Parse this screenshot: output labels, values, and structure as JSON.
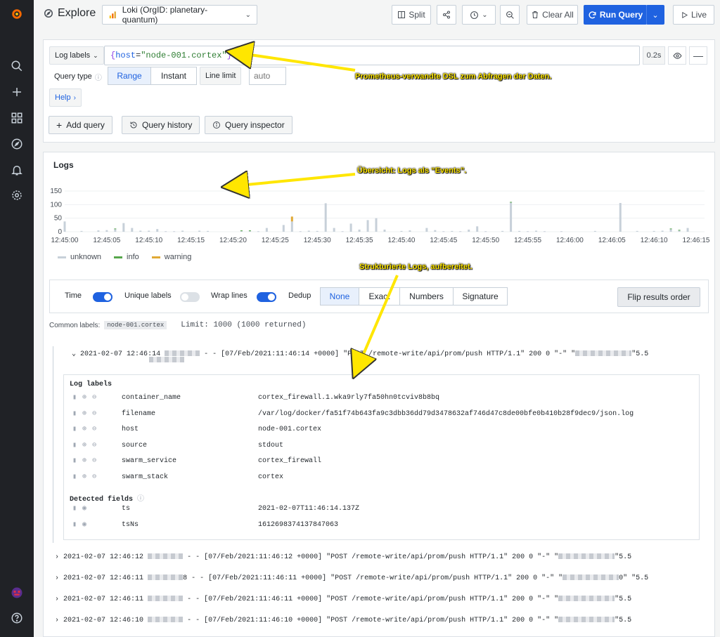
{
  "colors": {
    "primary": "#1f62e0",
    "sidebar": "#202226",
    "unknown": "#c7d0d9",
    "info": "#56a64b",
    "warning": "#e0a935",
    "annotation": "#ffe600"
  },
  "sidebar": {
    "items": [
      {
        "name": "grafana-logo-icon"
      },
      {
        "name": "search-icon"
      },
      {
        "name": "plus-icon"
      },
      {
        "name": "dashboards-icon"
      },
      {
        "name": "compass-icon"
      },
      {
        "name": "bell-icon"
      },
      {
        "name": "gear-icon"
      },
      {
        "name": "avatar"
      },
      {
        "name": "help-icon"
      }
    ]
  },
  "header": {
    "title": "Explore",
    "datasource": "Loki (OrgID: planetary-quantum)",
    "split": "Split",
    "clear_all": "Clear All",
    "run_query": "Run Query",
    "live": "Live"
  },
  "query": {
    "log_labels": "Log labels",
    "expression": {
      "brace_open": "{",
      "key": "host",
      "eq": "=",
      "value": "\"node-001.cortex\"",
      "brace_close": "}"
    },
    "duration": "0.2s",
    "query_type": "Query type",
    "range": "Range",
    "instant": "Instant",
    "line_limit": "Line limit",
    "line_limit_placeholder": "auto",
    "help": "Help",
    "add_query": "Add query",
    "query_history": "Query history",
    "query_inspector": "Query inspector"
  },
  "logs": {
    "title": "Logs",
    "legend": [
      "unknown",
      "info",
      "warning"
    ],
    "options": {
      "time": "Time",
      "unique_labels": "Unique labels",
      "wrap_lines": "Wrap lines",
      "dedup": "Dedup",
      "dedup_options": [
        "None",
        "Exact",
        "Numbers",
        "Signature"
      ],
      "flip": "Flip results order"
    },
    "common_labels": "Common labels:",
    "common_value": "node-001.cortex",
    "limit": "Limit: 1000 (1000 returned)",
    "rows": [
      {
        "ts": "2021-02-07 12:46:14",
        "line": " - - [07/Feb/2021:11:46:14 +0000] \"POST /remote-write/api/prom/push HTTP/1.1\" 200 0 \"-\" \"",
        "tail": "\"5.5",
        "expanded": true
      },
      {
        "ts": "2021-02-07 12:46:12",
        "line": " - - [07/Feb/2021:11:46:12 +0000] \"POST /remote-write/api/prom/push HTTP/1.1\" 200 0 \"-\" \"",
        "tail": "\"5.5"
      },
      {
        "ts": "2021-02-07 12:46:11",
        "line": "8 - - [07/Feb/2021:11:46:11 +0000] \"POST /remote-write/api/prom/push HTTP/1.1\" 200 0 \"-\" \"",
        "tail": "0\" \"5.5"
      },
      {
        "ts": "2021-02-07 12:46:11",
        "line": " - - [07/Feb/2021:11:46:11 +0000] \"POST /remote-write/api/prom/push HTTP/1.1\" 200 0 \"-\" \"",
        "tail": "\"5.5"
      },
      {
        "ts": "2021-02-07 12:46:10",
        "line": " - - [07/Feb/2021:11:46:10 +0000] \"POST /remote-write/api/prom/push HTTP/1.1\" 200 0 \"-\" \"",
        "tail": "\"5.5"
      }
    ],
    "detail": {
      "labels_title": "Log labels",
      "labels": [
        {
          "k": "container_name",
          "v": "cortex_firewall.1.wka9rly7fa50hn0tcviv8b8bq"
        },
        {
          "k": "filename",
          "v": "/var/log/docker/fa51f74b643fa9c3dbb36dd79d3478632af746d47c8de00bfe0b410b28f9dec9/json.log"
        },
        {
          "k": "host",
          "v": "node-001.cortex"
        },
        {
          "k": "source",
          "v": "stdout"
        },
        {
          "k": "swarm_service",
          "v": "cortex_firewall"
        },
        {
          "k": "swarm_stack",
          "v": "cortex"
        }
      ],
      "fields_title": "Detected fields",
      "fields": [
        {
          "k": "ts",
          "v": "2021-02-07T11:46:14.137Z"
        },
        {
          "k": "tsNs",
          "v": "1612698374137847063"
        }
      ]
    }
  },
  "annotations": {
    "a1": "Prometheus-verwandte DSL zum Abfragen der Daten.",
    "a2": "Übersicht: Logs als “Events”.",
    "a3": "Strukturierte Logs, aufbereitet."
  },
  "chart_data": {
    "type": "bar",
    "stacked": true,
    "ylim": [
      0,
      150
    ],
    "yticks": [
      "150",
      "100",
      "50",
      "0"
    ],
    "xticks": [
      "12:45:00",
      "12:45:05",
      "12:45:10",
      "12:45:15",
      "12:45:20",
      "12:45:25",
      "12:45:30",
      "12:45:35",
      "12:45:40",
      "12:45:45",
      "12:45:50",
      "12:45:55",
      "12:46:00",
      "12:46:05",
      "12:46:10",
      "12:46:15"
    ],
    "x_seconds": [
      0,
      1,
      2,
      3,
      4,
      5,
      6,
      7,
      8,
      9,
      10,
      11,
      12,
      13,
      14,
      15,
      16,
      17,
      18,
      19,
      20,
      21,
      22,
      23,
      24,
      25,
      26,
      27,
      28,
      29,
      30,
      31,
      32,
      33,
      34,
      35,
      36,
      37,
      38,
      39,
      40,
      41,
      42,
      43,
      44,
      45,
      46,
      47,
      48,
      49,
      50,
      51,
      52,
      53,
      54,
      55,
      56,
      57,
      58,
      59,
      60,
      61,
      62,
      63,
      64,
      65,
      66,
      67,
      68,
      69,
      70,
      71,
      72,
      73,
      74
    ],
    "series": [
      {
        "name": "unknown",
        "values": [
          38,
          0,
          3,
          0,
          5,
          6,
          10,
          32,
          14,
          4,
          4,
          10,
          2,
          2,
          4,
          0,
          4,
          3,
          0,
          0,
          0,
          3,
          3,
          2,
          14,
          0,
          25,
          38,
          2,
          4,
          3,
          105,
          14,
          2,
          30,
          8,
          43,
          50,
          8,
          0,
          3,
          5,
          0,
          14,
          6,
          2,
          3,
          2,
          8,
          20,
          2,
          0,
          3,
          108,
          3,
          2,
          4,
          2,
          0,
          2,
          0,
          0,
          0,
          3,
          0,
          0,
          106,
          0,
          3,
          0,
          3,
          4,
          10,
          5,
          14
        ]
      },
      {
        "name": "info",
        "values": [
          0,
          0,
          0,
          0,
          0,
          0,
          2,
          0,
          0,
          0,
          0,
          0,
          0,
          0,
          0,
          0,
          0,
          0,
          0,
          0,
          0,
          2,
          2,
          0,
          0,
          0,
          0,
          0,
          0,
          0,
          0,
          0,
          0,
          0,
          0,
          0,
          0,
          0,
          0,
          0,
          0,
          0,
          0,
          0,
          0,
          0,
          0,
          0,
          0,
          0,
          0,
          0,
          0,
          2,
          0,
          0,
          0,
          0,
          0,
          0,
          0,
          0,
          0,
          0,
          0,
          0,
          0,
          0,
          0,
          0,
          0,
          0,
          2,
          2,
          0
        ]
      },
      {
        "name": "warning",
        "values": [
          0,
          0,
          0,
          0,
          0,
          0,
          0,
          0,
          0,
          0,
          0,
          0,
          0,
          0,
          0,
          0,
          0,
          0,
          0,
          0,
          0,
          0,
          0,
          0,
          0,
          0,
          0,
          18,
          0,
          0,
          0,
          0,
          0,
          0,
          0,
          0,
          0,
          0,
          0,
          0,
          0,
          0,
          0,
          0,
          0,
          0,
          0,
          0,
          0,
          0,
          0,
          0,
          0,
          0,
          0,
          0,
          0,
          0,
          0,
          0,
          0,
          0,
          0,
          0,
          0,
          0,
          0,
          0,
          0,
          0,
          0,
          0,
          0,
          0,
          0
        ]
      }
    ],
    "legend": [
      "unknown",
      "info",
      "warning"
    ],
    "legend_position": "bottom-left"
  }
}
